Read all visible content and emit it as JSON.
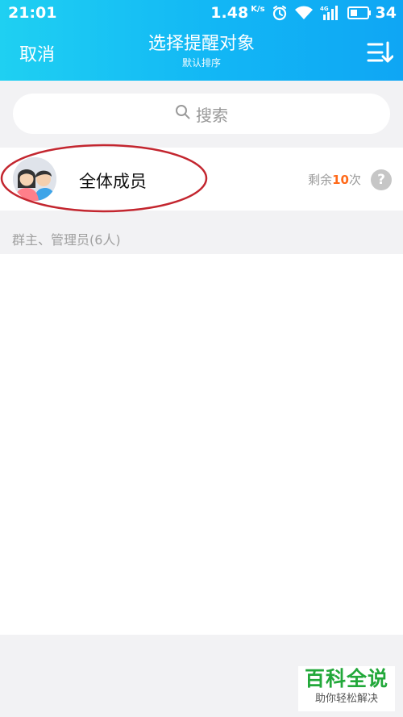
{
  "status": {
    "time": "21:01",
    "speed": "1.48",
    "speed_unit": "K/s",
    "network": "4G",
    "battery": "34"
  },
  "header": {
    "cancel": "取消",
    "title": "选择提醒对象",
    "subtitle": "默认排序"
  },
  "search": {
    "placeholder": "搜索"
  },
  "all_members": {
    "name": "全体成员",
    "remain_prefix": "剩余",
    "remain_count": "10",
    "remain_suffix": "次",
    "help": "?"
  },
  "section": {
    "label": "群主、管理员(6人)"
  },
  "watermark": {
    "title": "百科全说",
    "subtitle": "助你轻松解决"
  },
  "colors": {
    "header_start": "#1fd0f2",
    "header_end": "#0fa6f4",
    "accent_count": "#ff6a1a",
    "annotation": "#c3262f"
  }
}
